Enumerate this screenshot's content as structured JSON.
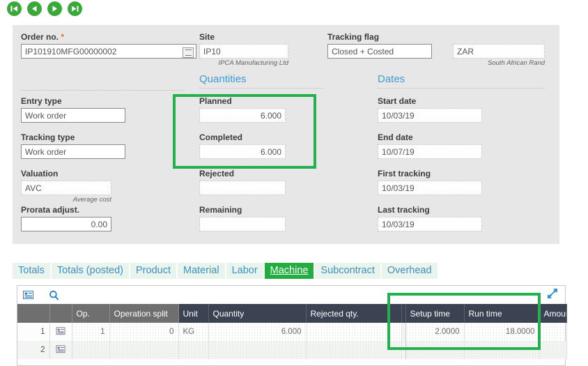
{
  "navigation": {
    "buttons": [
      {
        "name": "first-record",
        "icon": "skip-back-icon"
      },
      {
        "name": "previous-record",
        "icon": "triangle-left-icon"
      },
      {
        "name": "next-record",
        "icon": "triangle-right-icon"
      },
      {
        "name": "last-record",
        "icon": "skip-forward-icon"
      }
    ],
    "accent_color": "#3aa93a"
  },
  "header_panel": {
    "order_no": {
      "label": "Order no.",
      "required_marker": "*",
      "value": "IP101910MFG00000002"
    },
    "site": {
      "label": "Site",
      "value": "IP10",
      "helper": "IPCA Manufacturing Ltd"
    },
    "tracking_flag": {
      "label": "Tracking flag",
      "value": "Closed + Costed"
    },
    "currency": {
      "value": "ZAR",
      "helper": "South African Rand"
    },
    "entry_type": {
      "label": "Entry type",
      "value": "Work order"
    },
    "tracking_type": {
      "label": "Tracking type",
      "value": "Work order"
    },
    "valuation": {
      "label": "Valuation",
      "value": "AVC",
      "helper": "Average cost"
    },
    "prorata_adjust": {
      "label": "Prorata adjust.",
      "value": "0.00"
    }
  },
  "quantities": {
    "section_title": "Quantities",
    "planned": {
      "label": "Planned",
      "value": "6.000"
    },
    "completed": {
      "label": "Completed",
      "value": "6.000"
    },
    "rejected": {
      "label": "Rejected",
      "value": ""
    },
    "remaining": {
      "label": "Remaining",
      "value": ""
    }
  },
  "dates": {
    "section_title": "Dates",
    "start_date": {
      "label": "Start date",
      "value": "10/03/19"
    },
    "end_date": {
      "label": "End date",
      "value": "10/07/19"
    },
    "first_tracking": {
      "label": "First tracking",
      "value": "10/03/19"
    },
    "last_tracking": {
      "label": "Last tracking",
      "value": "10/03/19"
    }
  },
  "tabs": {
    "items": [
      {
        "label": "Totals",
        "active": false
      },
      {
        "label": "Totals (posted)",
        "active": false
      },
      {
        "label": "Product",
        "active": false
      },
      {
        "label": "Material",
        "active": false
      },
      {
        "label": "Labor",
        "active": false
      },
      {
        "label": "Machine",
        "active": true
      },
      {
        "label": "Subcontract",
        "active": false
      },
      {
        "label": "Overhead",
        "active": false
      }
    ],
    "active_color": "#21ad3f",
    "inactive_bg": "#e9f5ec",
    "inactive_text": "#3f8fc4"
  },
  "grid": {
    "toolbar": [
      {
        "name": "record-detail-icon"
      },
      {
        "name": "search-icon"
      }
    ],
    "expand_icon": "expand-arrows-icon",
    "columns": [
      {
        "label": "",
        "style": "gray"
      },
      {
        "label": "",
        "style": "gray"
      },
      {
        "label": "Op.",
        "style": "gray"
      },
      {
        "label": "Operation split",
        "style": "gray"
      },
      {
        "label": "Unit",
        "style": "dark"
      },
      {
        "label": "Quantity",
        "style": "dark"
      },
      {
        "label": "Rejected qty.",
        "style": "dark"
      },
      {
        "label": "",
        "style": "dark"
      },
      {
        "label": "Setup time",
        "style": "dark"
      },
      {
        "label": "Run time",
        "style": "dark"
      },
      {
        "label": "Amoun",
        "style": "dark"
      }
    ],
    "rows": [
      {
        "num": "1",
        "op": "1",
        "operation_split": "0",
        "unit": "KG",
        "quantity": "6.000",
        "rejected_qty": "",
        "blank": "",
        "setup_time": "2.0000",
        "run_time": "18.0000",
        "amount": ""
      },
      {
        "num": "2",
        "op": "",
        "operation_split": "",
        "unit": "",
        "quantity": "",
        "rejected_qty": "",
        "blank": "",
        "setup_time": "",
        "run_time": "",
        "amount": ""
      }
    ]
  },
  "highlights": {
    "color": "#22b14c",
    "boxes": [
      {
        "name": "quantities-highlight",
        "target": "Planned / Completed quantity fields"
      },
      {
        "name": "times-highlight",
        "target": "Setup time / Run time columns"
      }
    ]
  }
}
